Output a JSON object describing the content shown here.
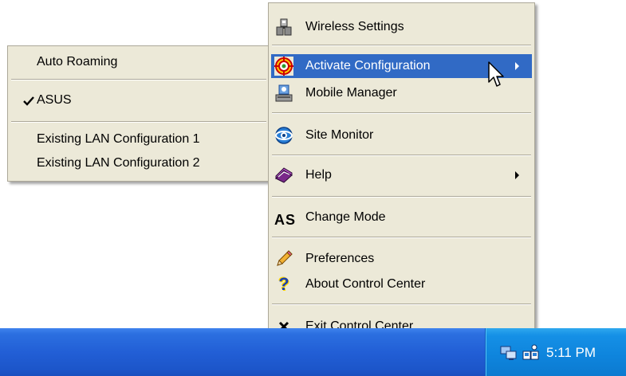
{
  "main_menu": {
    "items": [
      {
        "label": "Wireless Settings",
        "icon": "wireless-settings-icon",
        "submenu": false,
        "highlighted": false
      },
      {
        "label": "Activate Configuration",
        "icon": "target-icon",
        "submenu": true,
        "highlighted": true
      },
      {
        "label": "Mobile Manager",
        "icon": "mobile-manager-icon",
        "submenu": false,
        "highlighted": false
      },
      {
        "label": "Site Monitor",
        "icon": "site-monitor-icon",
        "submenu": false,
        "highlighted": false
      },
      {
        "label": "Help",
        "icon": "help-book-icon",
        "submenu": true,
        "highlighted": false
      },
      {
        "label": "Change Mode",
        "icon": "change-mode-icon",
        "submenu": false,
        "highlighted": false
      },
      {
        "label": "Preferences",
        "icon": "pencil-icon",
        "submenu": false,
        "highlighted": false
      },
      {
        "label": "About Control Center",
        "icon": "question-icon",
        "submenu": false,
        "highlighted": false
      },
      {
        "label": "Exit Control Center",
        "icon": "close-icon",
        "submenu": false,
        "highlighted": false
      }
    ],
    "change_mode_icon_text": "AS"
  },
  "sub_menu": {
    "items": [
      {
        "label": "Auto Roaming",
        "checked": false
      },
      {
        "label": "ASUS",
        "checked": true
      },
      {
        "label": "Existing LAN Configuration 1",
        "checked": false
      },
      {
        "label": "Existing LAN Configuration 2",
        "checked": false
      }
    ]
  },
  "taskbar": {
    "clock": "5:11 PM",
    "tray_icons": [
      "network-icon",
      "wireless-utility-icon"
    ]
  },
  "colors": {
    "menu_bg": "#ece9d8",
    "highlight": "#316ac5",
    "taskbar": "#225fd6",
    "tray": "#0e84dc"
  }
}
